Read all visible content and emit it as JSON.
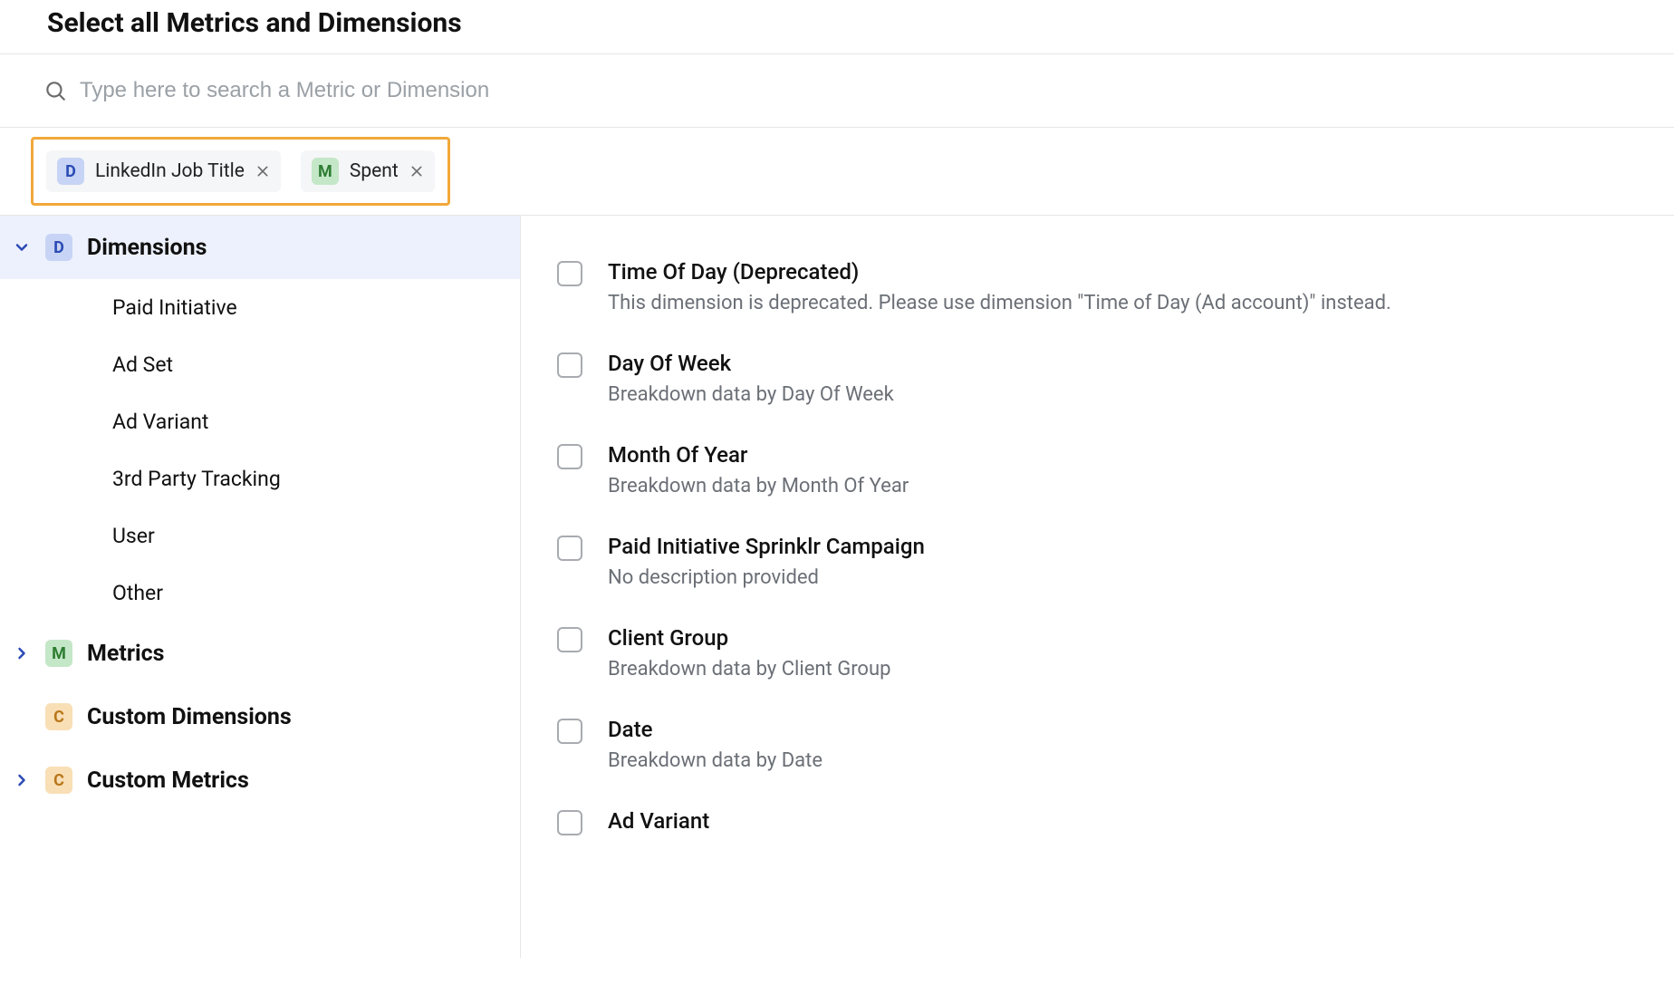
{
  "page": {
    "title": "Select all Metrics and Dimensions"
  },
  "search": {
    "placeholder": "Type here to search a Metric or Dimension",
    "value": ""
  },
  "chips": [
    {
      "badge": "D",
      "badgeClass": "badge-d",
      "label": "LinkedIn Job Title"
    },
    {
      "badge": "M",
      "badgeClass": "badge-m",
      "label": "Spent"
    }
  ],
  "sidebar": {
    "groups": [
      {
        "badge": "D",
        "badgeClass": "badge-d",
        "label": "Dimensions",
        "expanded": true,
        "active": true,
        "items": [
          "Paid Initiative",
          "Ad Set",
          "Ad Variant",
          "3rd Party Tracking",
          "User",
          "Other"
        ]
      },
      {
        "badge": "M",
        "badgeClass": "badge-m",
        "label": "Metrics",
        "expanded": false
      },
      {
        "badge": "C",
        "badgeClass": "badge-c",
        "label": "Custom Dimensions",
        "expanded": null
      },
      {
        "badge": "C",
        "badgeClass": "badge-c",
        "label": "Custom Metrics",
        "expanded": false
      }
    ]
  },
  "dimensions_list": [
    {
      "label": "Time Of Day (Deprecated)",
      "description": "This dimension is deprecated. Please use dimension \"Time of Day (Ad account)\" instead."
    },
    {
      "label": "Day Of Week",
      "description": "Breakdown data by Day Of Week"
    },
    {
      "label": "Month Of Year",
      "description": "Breakdown data by Month Of Year"
    },
    {
      "label": "Paid Initiative Sprinklr Campaign",
      "description": "No description provided"
    },
    {
      "label": "Client Group",
      "description": "Breakdown data by Client Group"
    },
    {
      "label": "Date",
      "description": "Breakdown data by Date"
    },
    {
      "label": "Ad Variant",
      "description": ""
    }
  ]
}
